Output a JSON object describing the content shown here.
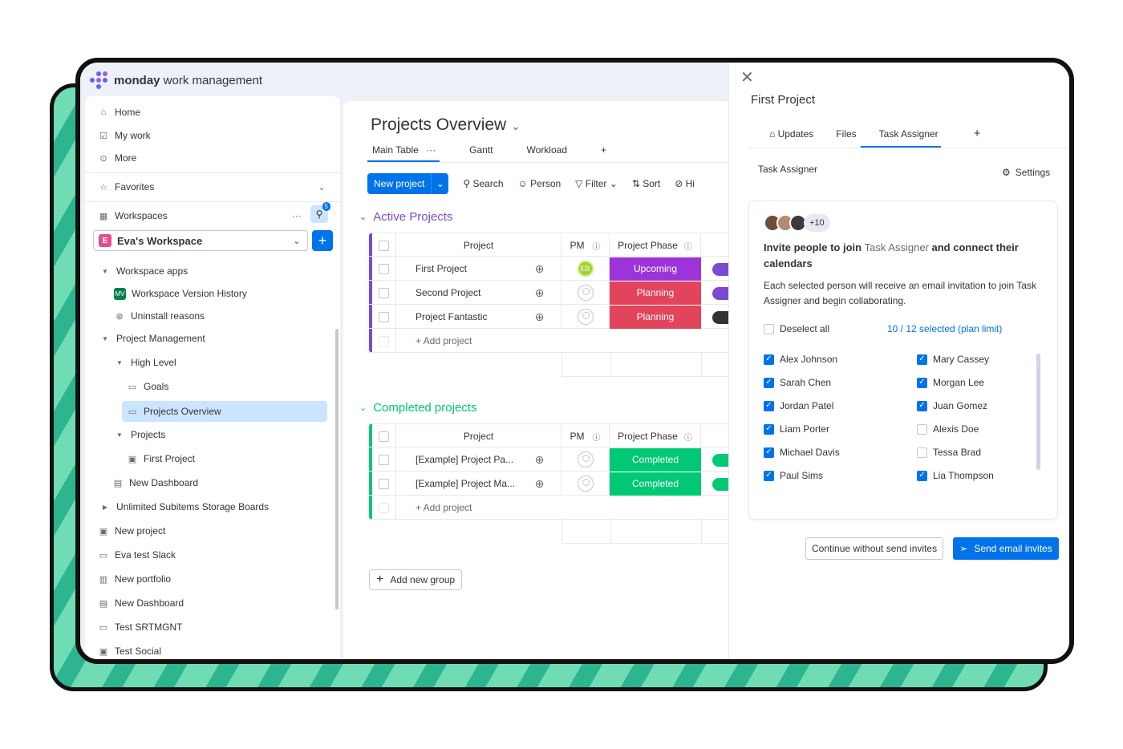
{
  "app": {
    "brand_bold": "monday",
    "brand_rest": " work management"
  },
  "sidebar": {
    "home": "Home",
    "my_work": "My work",
    "more": "More",
    "favorites": "Favorites",
    "workspaces": "Workspaces",
    "search_badge": "5",
    "workspace_name": "Eva's Workspace",
    "workspace_avatar": "E",
    "workspace_apps": "Workspace apps",
    "version_history": "Workspace Version History",
    "version_badge": "MV",
    "uninstall": "Uninstall reasons",
    "project_management": "Project Management",
    "high_level": "High Level",
    "goals": "Goals",
    "projects_overview": "Projects Overview",
    "projects": "Projects",
    "first_project": "First Project",
    "new_dashboard_1": "New Dashboard",
    "unlimited": "Unlimited Subitems Storage Boards",
    "new_project": "New project",
    "eva_test": "Eva test Slack",
    "new_portfolio": "New portfolio",
    "new_dashboard_2": "New Dashboard",
    "test_srtmgnt": "Test SRTMGNT",
    "test_social": "Test Social"
  },
  "main": {
    "title": "Projects Overview",
    "tabs": [
      "Main Table",
      "Gantt",
      "Workload"
    ],
    "tab_more": "···",
    "tab_add": "+",
    "toolbar": {
      "new_project": "New project",
      "search": "Search",
      "person": "Person",
      "filter": "Filter",
      "sort": "Sort",
      "hide": "Hi"
    },
    "columns": {
      "project": "Project",
      "pm": "PM",
      "phase": "Project Phase"
    },
    "active_group": {
      "title": "Active Projects",
      "color": "#784bd1",
      "rows": [
        {
          "name": "First Project",
          "pm": "EB",
          "phase": "Upcoming",
          "phase_color": "#9d34da",
          "end_color": "#784bd1"
        },
        {
          "name": "Second Project",
          "pm": "",
          "phase": "Planning",
          "phase_color": "#e2445c",
          "end_color": "#784bd1"
        },
        {
          "name": "Project Fantastic",
          "pm": "",
          "phase": "Planning",
          "phase_color": "#e2445c",
          "end_color": "#333333"
        }
      ],
      "add_label": "+ Add project"
    },
    "completed_group": {
      "title": "Completed projects",
      "color": "#00c875",
      "rows": [
        {
          "name": "[Example] Project Pa...",
          "phase": "Completed",
          "phase_color": "#00c875"
        },
        {
          "name": "[Example] Project Ma...",
          "phase": "Completed",
          "phase_color": "#00c875"
        }
      ],
      "add_label": "+ Add project"
    },
    "add_group": "Add new group"
  },
  "panel": {
    "title": "First Project",
    "tabs": [
      "Updates",
      "Files",
      "Task Assigner"
    ],
    "tab_add": "+",
    "section": "Task Assigner",
    "settings": "Settings",
    "more_count": "+10",
    "heading_pre": "Invite people to join ",
    "heading_app": "Task Assigner",
    "heading_post": " and connect their calendars",
    "description": "Each selected person will receive an email invitation to join Task Assigner and begin collaborating.",
    "deselect_all": "Deselect all",
    "selected_info": "10 / 12 selected (plan limit)",
    "people_left": [
      {
        "name": "Alex Johnson",
        "checked": true
      },
      {
        "name": "Sarah Chen",
        "checked": true
      },
      {
        "name": "Jordan Patel",
        "checked": true
      },
      {
        "name": "Liam Porter",
        "checked": true
      },
      {
        "name": "Michael Davis",
        "checked": true
      },
      {
        "name": "Paul Sims",
        "checked": true
      }
    ],
    "people_right": [
      {
        "name": "Mary Cassey",
        "checked": true
      },
      {
        "name": "Morgan Lee",
        "checked": true
      },
      {
        "name": "Juan Gomez",
        "checked": true
      },
      {
        "name": "Alexis Doe",
        "checked": false
      },
      {
        "name": "Tessa  Brad",
        "checked": false
      },
      {
        "name": "Lia Thompson",
        "checked": true
      }
    ],
    "continue_btn": "Continue without send invites",
    "send_btn": "Send email invites"
  }
}
